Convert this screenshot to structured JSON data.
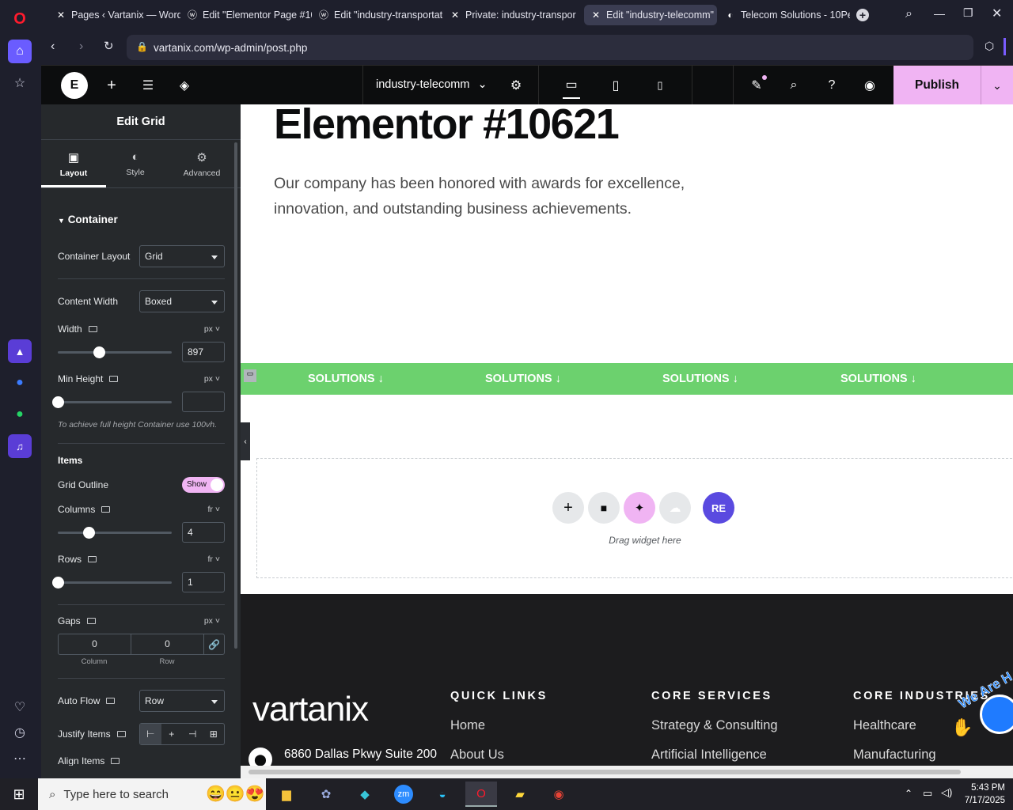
{
  "browser": {
    "tabs": [
      {
        "label": "Pages ‹ Vartanix — WordP",
        "icon": "elementor-x-icon"
      },
      {
        "label": "Edit \"Elementor Page #10",
        "icon": "wordpress-icon"
      },
      {
        "label": "Edit \"industry-transportati",
        "icon": "wordpress-icon"
      },
      {
        "label": "Private: industry-transpor",
        "icon": "elementor-x-icon"
      },
      {
        "label": "Edit \"industry-telecomm\"",
        "icon": "elementor-x-icon",
        "active": true
      },
      {
        "label": "Telecom Solutions - 10Pe",
        "icon": "tenpearls-icon"
      }
    ],
    "url": "vartanix.com/wp-admin/post.php"
  },
  "editor": {
    "page_name": "industry-telecomm",
    "publish_label": "Publish"
  },
  "panel": {
    "title": "Edit Grid",
    "tabs": [
      "Layout",
      "Style",
      "Advanced"
    ],
    "section": "Container",
    "container_layout": {
      "label": "Container Layout",
      "value": "Grid"
    },
    "content_width": {
      "label": "Content Width",
      "value": "Boxed"
    },
    "width": {
      "label": "Width",
      "unit": "px",
      "value": "897",
      "level": 0.36
    },
    "min_height": {
      "label": "Min Height",
      "unit": "px",
      "value": "",
      "level": 0
    },
    "hint": "To achieve full height Container use 100vh.",
    "items_heading": "Items",
    "grid_outline": {
      "label": "Grid Outline",
      "toggle": "Show"
    },
    "columns": {
      "label": "Columns",
      "unit": "fr",
      "value": "4",
      "level": 0.27
    },
    "rows": {
      "label": "Rows",
      "unit": "fr",
      "value": "1",
      "level": 0
    },
    "gaps": {
      "label": "Gaps",
      "unit": "px",
      "column": "0",
      "row": "0",
      "column_label": "Column",
      "row_label": "Row"
    },
    "auto_flow": {
      "label": "Auto Flow",
      "value": "Row"
    },
    "justify_items": {
      "label": "Justify Items"
    },
    "align_items": {
      "label": "Align Items"
    }
  },
  "canvas": {
    "heading": "Elementor #10621",
    "paragraph_line1": "Our company has been honored with awards for excellence,",
    "paragraph_line2": "innovation, and outstanding business achievements.",
    "ticker": [
      "SOLUTIONS ↓",
      "SOLUTIONS ↓",
      "SOLUTIONS ↓",
      "SOLUTIONS ↓"
    ],
    "drop_label": "Drag widget here",
    "re_badge": "RE",
    "footer": {
      "logo": "vartanix",
      "address": "6860 Dallas Pkwy Suite 200",
      "columns": [
        {
          "heading": "QUICK LINKS",
          "links": [
            "Home",
            "About Us"
          ]
        },
        {
          "heading": "CORE SERVICES",
          "links": [
            "Strategy & Consulting",
            "Artificial Intelligence"
          ]
        },
        {
          "heading": "CORE INDUSTRIES",
          "links": [
            "Healthcare",
            "Manufacturing"
          ]
        }
      ],
      "sticker": "We Are H"
    }
  },
  "taskbar": {
    "search_placeholder": "Type here to search",
    "time": "5:43 PM",
    "date": "7/17/2025",
    "zm_label": "zm"
  },
  "colors": {
    "accent_pink": "#f0b4f3",
    "ticker_green": "#6cd16e",
    "panel_bg": "#26292c"
  }
}
